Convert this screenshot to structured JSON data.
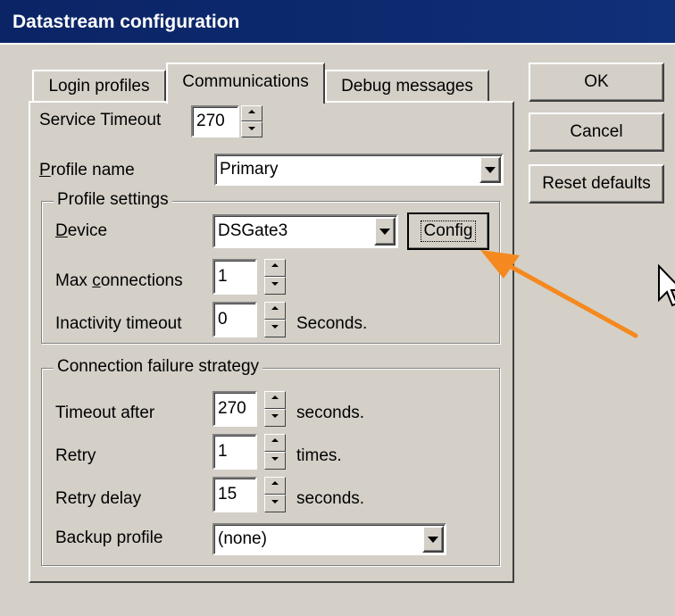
{
  "window": {
    "title": "Datastream configuration"
  },
  "tabs": [
    {
      "label": "Login profiles"
    },
    {
      "label": "Communications"
    },
    {
      "label": "Debug messages"
    }
  ],
  "buttons": {
    "ok": "OK",
    "cancel": "Cancel",
    "reset": "Reset defaults",
    "config": "Config"
  },
  "service_timeout": {
    "label": "Service Timeout",
    "value": "270"
  },
  "profile_name": {
    "label_first": "P",
    "label_rest": "rofile name",
    "value": "Primary"
  },
  "profile_settings": {
    "legend": "Profile settings",
    "device": {
      "label_first": "D",
      "label_rest": "evice",
      "value": "DSGate3"
    },
    "max_connections": {
      "label_a": "Max ",
      "label_ul": "c",
      "label_b": "onnections",
      "value": "1"
    },
    "inactivity_timeout": {
      "label": "Inactivity timeout",
      "value": "0",
      "unit": "Seconds."
    }
  },
  "connection_failure": {
    "legend": "Connection failure strategy",
    "timeout_after": {
      "label": "Timeout after",
      "value": "270",
      "unit": "seconds."
    },
    "retry": {
      "label": "Retry",
      "value": "1",
      "unit": "times."
    },
    "retry_delay": {
      "label": "Retry delay",
      "value": "15",
      "unit": "seconds."
    },
    "backup_profile": {
      "label": "Backup profile",
      "value": "(none)"
    }
  },
  "colors": {
    "titlebar": "#0b2466",
    "face": "#d4d0c8",
    "arrow": "#f5891f"
  }
}
